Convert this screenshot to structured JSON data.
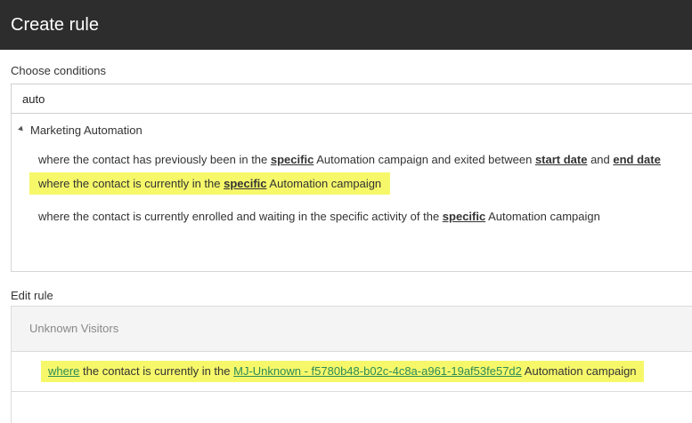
{
  "header": {
    "title": "Create rule"
  },
  "conditions": {
    "label": "Choose conditions",
    "search_value": "auto",
    "category": "Marketing Automation",
    "items": [
      {
        "pre": "where the contact has previously been in the ",
        "kw1": "specific",
        "mid": " Automation campaign and exited between ",
        "kw2": "start date",
        "and": " and ",
        "kw3": "end date"
      },
      {
        "pre": "where the contact is currently in the ",
        "kw1": "specific",
        "post": " Automation campaign"
      },
      {
        "pre": "where the contact is currently enrolled and waiting in the specific activity of the ",
        "kw1": "specific",
        "post": " Automation campaign"
      }
    ]
  },
  "edit_rule": {
    "label": "Edit rule",
    "group_name": "Unknown Visitors",
    "rule": {
      "where": "where",
      "pre": " the contact is currently in the ",
      "campaign": "MJ-Unknown - f5780b48-b02c-4c8a-a961-19af53fe57d2",
      "post": " Automation campaign"
    }
  },
  "colors": {
    "header_bg": "#2d2d2d",
    "highlight": "#f6f86a",
    "link_green": "#2e8b57"
  }
}
